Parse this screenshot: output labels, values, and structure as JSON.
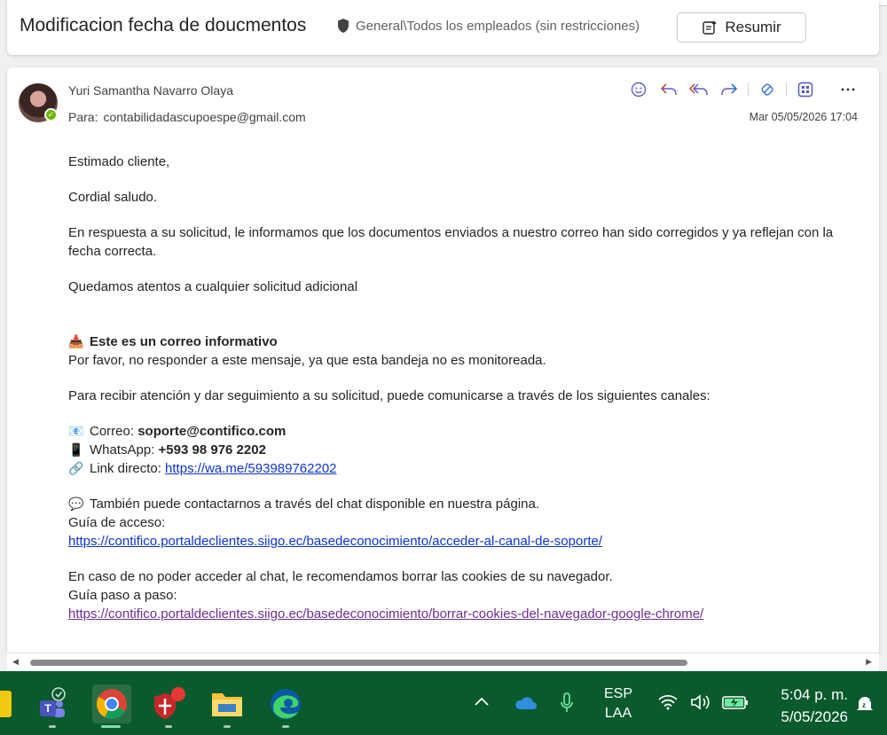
{
  "header": {
    "subject": "Modificacion fecha de doucmentos",
    "sensitivity": "General\\Todos los empleados (sin restricciones)",
    "summarize_label": "Resumir"
  },
  "message": {
    "sender": "Yuri Samantha Navarro Olaya",
    "to_label": "Para:",
    "to_address": "contabilidadascupoespe@gmail.com",
    "date": "Mar 05/05/2026 17:04",
    "actions": [
      "emoji-react",
      "reply",
      "reply-all",
      "forward",
      "loop",
      "apps",
      "more"
    ],
    "body": {
      "greeting": "Estimado cliente,",
      "salutation": "Cordial saludo.",
      "paragraph1": "En respuesta a su solicitud, le informamos que los documentos enviados a nuestro correo han sido corregidos y ya reflejan con la fecha correcta.",
      "paragraph2": "Quedamos atentos a cualquier solicitud adicional",
      "info_title": "Este es un correo informativo",
      "info_text": "Por favor, no responder a este mensaje, ya que esta bandeja no es monitoreada.",
      "channels_intro": "Para recibir atención y dar seguimiento a su solicitud, puede comunicarse a través de los siguientes canales:",
      "email_label": "Correo: ",
      "email_value": "soporte@contifico.com",
      "whatsapp_label": "WhatsApp: ",
      "whatsapp_value": "+593 98 976 2202",
      "link_label": "Link directo: ",
      "link_value": "https://wa.me/593989762202",
      "chat_text": "También puede contactarnos a través del chat disponible en nuestra página.",
      "guide_label": "Guía de acceso:",
      "guide_link": "https://contifico.portaldeclientes.siigo.ec/basedeconocimiento/acceder-al-canal-de-soporte/",
      "cookies_text": "En caso de no poder acceder al chat, le recomendamos borrar las cookies de su navegador.",
      "cookies_guide_label": "Guía paso a paso:",
      "cookies_link": "https://contifico.portaldeclientes.siigo.ec/basedeconocimiento/borrar-cookies-del-navegador-google-chrome/"
    }
  },
  "taskbar": {
    "apps": [
      "files-app",
      "teams",
      "chrome",
      "security-app",
      "file-explorer",
      "edge"
    ],
    "language_line1": "ESP",
    "language_line2": "LAA",
    "time": "5:04 p. m.",
    "date": "5/05/2026"
  },
  "colors": {
    "taskbar": "#0a5a2e",
    "link": "#0c35c9",
    "visited_link": "#6b2d8f",
    "action_icons": "#5b5fc7"
  }
}
